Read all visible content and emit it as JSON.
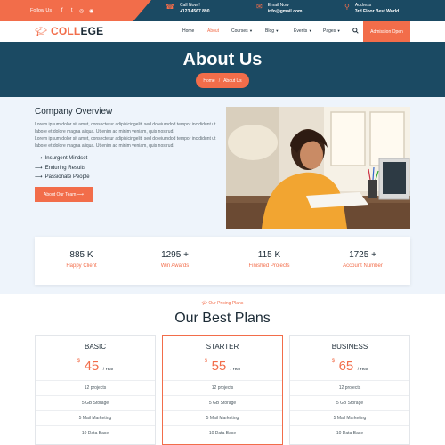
{
  "topbar": {
    "follow_label": "Follow Us",
    "social": [
      "f",
      "t",
      "◎",
      "◉"
    ],
    "contacts": [
      {
        "icon": "phone-icon",
        "glyph": "☎",
        "label": "Call Now !",
        "value": "+123 4567 890"
      },
      {
        "icon": "mail-icon",
        "glyph": "✉",
        "label": "Email Now",
        "value": "info@gmail.com"
      },
      {
        "icon": "location-icon",
        "glyph": "⚲",
        "label": "Address",
        "value": "3rd Floor Best World."
      }
    ]
  },
  "header": {
    "logo_accent": "COLL",
    "logo_rest": "EGE",
    "nav": [
      "Home",
      "About",
      "Courses",
      "Blog",
      "Events",
      "Pages"
    ],
    "admission_label": "Admission Open"
  },
  "hero": {
    "title": "About Us",
    "crumb_home": "Home",
    "crumb_sep": "/",
    "crumb_current": "About Us"
  },
  "overview": {
    "title": "Company Overview",
    "para1": "Lorem ipsum dolor sit amet, consectetur adipisicingelit, sed do eiumdod tempor incididunt ut labore et dolore magna aliqua. Ut enim ad minim veniam, quis nostrud.",
    "para2": "Lorem ipsum dolor sit amet, consectetur adipisicingelit, sed do eiumdod tempor incididunt ut labore et dolore magna aliqua. Ut enim ad minim veniam, quis nostrud.",
    "list": [
      "Insurgent Mindset",
      "Enduring Results",
      "Passionate People"
    ],
    "button_label": "About Our Team"
  },
  "stats": [
    {
      "num": "885 K",
      "label": "Happy Client"
    },
    {
      "num": "1295 +",
      "label": "Win Awards"
    },
    {
      "num": "115 K",
      "label": "Finished Projects"
    },
    {
      "num": "1725 +",
      "label": "Account Number"
    }
  ],
  "plans": {
    "tag": "Our Pricing Plans",
    "title": "Our Best Plans",
    "cards": [
      {
        "name": "BASIC",
        "currency": "$",
        "price": "45",
        "per": "/ Year",
        "features": [
          "12 projects",
          "5 GB Storage",
          "5 Mail Marketing",
          "10 Data Base"
        ]
      },
      {
        "name": "STARTER",
        "currency": "$",
        "price": "55",
        "per": "/ Year",
        "features": [
          "12 projects",
          "5 GB Storage",
          "5 Mail Marketing",
          "10 Data Base"
        ]
      },
      {
        "name": "BUSINESS",
        "currency": "$",
        "price": "65",
        "per": "/ Year",
        "features": [
          "12 projects",
          "5 GB Storage",
          "5 Mail Marketing",
          "10 Data Base"
        ]
      }
    ]
  },
  "colors": {
    "accent": "#f26d4a",
    "navy": "#1b4a63",
    "light_bg": "#eef4fb"
  }
}
